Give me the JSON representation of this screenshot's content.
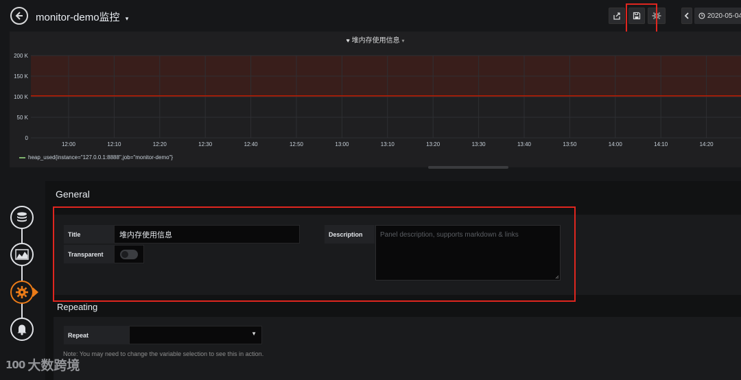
{
  "topbar": {
    "dashboard_title": "monitor-demo监控",
    "time_range": "2020-05-04",
    "icons": [
      "back-arrow-icon",
      "share-icon",
      "save-icon",
      "settings-icon",
      "chevron-left-icon",
      "clock-icon"
    ]
  },
  "panel": {
    "title": "堆内存使用信息",
    "legend": "heap_used{instance=\"127.0.0.1:8888\",job=\"monitor-demo\"}",
    "chart_data": {
      "type": "line",
      "title": "堆内存使用信息",
      "y_ticks": [
        "200 K",
        "150 K",
        "100 K",
        "50 K",
        "0"
      ],
      "x_ticks": [
        "12:00",
        "12:10",
        "12:20",
        "12:30",
        "12:40",
        "12:50",
        "13:00",
        "13:10",
        "13:20",
        "13:30",
        "13:40",
        "13:50",
        "14:00",
        "14:10",
        "14:20"
      ],
      "ylim": [
        0,
        200000
      ],
      "series": [
        {
          "name": "heap_used{instance=\"127.0.0.1:8888\",job=\"monitor-demo\"}",
          "values": [
            102000,
            102000
          ]
        }
      ],
      "threshold_from": 102000,
      "threshold_color": "#bf1b00",
      "series_color": "#7eb26d",
      "grid": true
    }
  },
  "general": {
    "heading": "General",
    "title_label": "Title",
    "title_value": "堆内存使用信息",
    "transparent_label": "Transparent",
    "transparent_on": false,
    "description_label": "Description",
    "description_placeholder": "Panel description, supports markdown & links"
  },
  "repeating": {
    "heading": "Repeating",
    "repeat_label": "Repeat",
    "repeat_value": "",
    "note": "Note: You may need to change the variable selection to see this in action."
  },
  "stepper": {
    "steps": [
      "database-icon",
      "visualization-icon",
      "general-settings-icon",
      "alert-bell-icon"
    ],
    "active_index": 2,
    "active_color": "#eb7b18"
  },
  "watermark": {
    "logo": "100",
    "text": "大数跨境"
  },
  "colors": {
    "highlight_box": "#e0261f",
    "background": "#161719",
    "panel": "#1f1f21"
  }
}
